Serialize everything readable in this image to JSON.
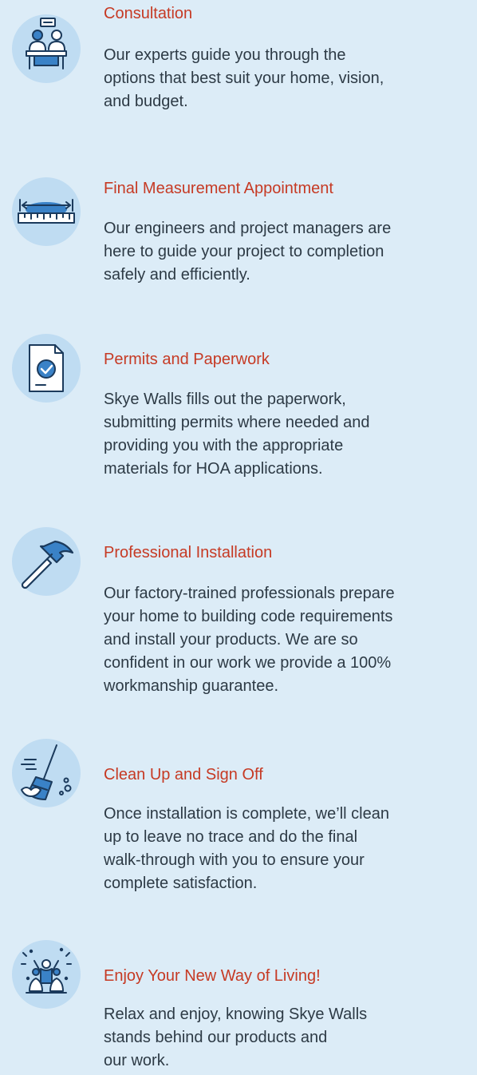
{
  "steps": [
    {
      "icon": "consultation-icon",
      "title": "Consultation",
      "lines": [
        "Our experts guide you through the",
        "options that best suit your home, vision,",
        "and budget."
      ]
    },
    {
      "icon": "measurement-ruler-icon",
      "title": "Final Measurement Appointment",
      "lines": [
        "Our engineers and project managers are",
        "here to guide your project to completion",
        "safely and efficiently."
      ]
    },
    {
      "icon": "permit-document-icon",
      "title": "Permits and Paperwork",
      "lines": [
        "Skye Walls fills out the paperwork,",
        "submitting permits where needed and",
        "providing you with the appropriate",
        "materials for HOA applications."
      ]
    },
    {
      "icon": "hammer-icon",
      "title": "Professional Installation",
      "lines": [
        "Our factory-trained professionals prepare",
        "your home to building code requirements",
        "and install your products. We are so",
        "confident in our work we provide a 100%",
        "workmanship guarantee."
      ]
    },
    {
      "icon": "broom-icon",
      "title": "Clean Up and Sign Off",
      "lines": [
        "Once installation is complete, we’ll clean",
        "up to leave no trace and do the final",
        "walk-through with you to ensure your",
        "complete satisfaction."
      ]
    },
    {
      "icon": "celebration-icon",
      "title": "Enjoy Your New Way of Living!",
      "lines": [
        "Relax and enjoy, knowing Skye Walls",
        "stands behind our products and",
        "our work."
      ]
    }
  ],
  "colors": {
    "background": "#dcecf7",
    "icon_circle": "#bfdcf2",
    "title": "#c63a24",
    "body_text": "#2d3a45",
    "icon_stroke": "#1b3a5c",
    "icon_accent": "#3a82c7"
  }
}
